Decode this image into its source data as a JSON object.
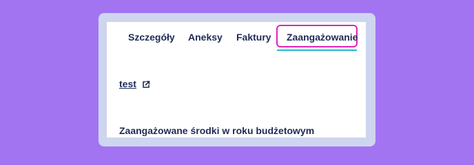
{
  "tabs": {
    "items": [
      {
        "label": "Szczegóły"
      },
      {
        "label": "Aneksy"
      },
      {
        "label": "Faktury"
      },
      {
        "label": "Zaangażowanie"
      }
    ],
    "active_index": 3
  },
  "link": {
    "label": "test",
    "icon": "external-link-icon"
  },
  "section": {
    "title": "Zaangażowane środki w roku budżetowym"
  },
  "colors": {
    "background": "#a374f2",
    "frame": "#cdd6ee",
    "text": "#1f2a55",
    "active_tab_outline": "#e024b6",
    "active_tab_underline": "#2ab5cf"
  }
}
